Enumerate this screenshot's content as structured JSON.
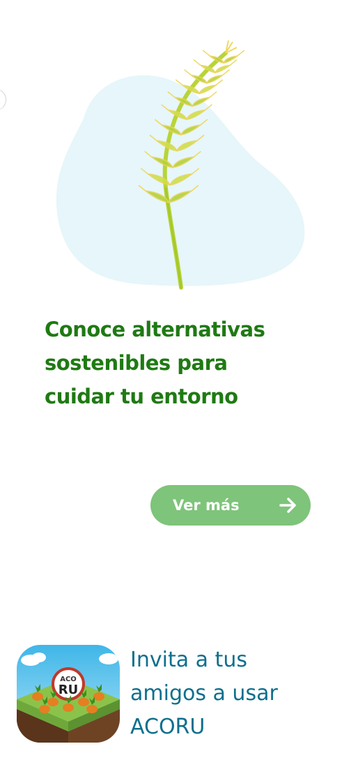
{
  "hero": {
    "image_name": "wheat-illustration",
    "blob_color": "#e6f6fa",
    "stalk_color": "#b8d438"
  },
  "headline": {
    "text": "Conoce alternativas sostenibles para cuidar tu entorno",
    "color": "#1f7a13"
  },
  "cta": {
    "label": "Ver más",
    "icon": "arrow-right-icon",
    "bg_color": "#7ec47a"
  },
  "invite": {
    "app_icon": "acoru-app-icon",
    "logo_line1": "ACO",
    "logo_line2": "RU",
    "text": "Invita a tus amigos a usar ACORU",
    "color": "#0e6f8d"
  }
}
